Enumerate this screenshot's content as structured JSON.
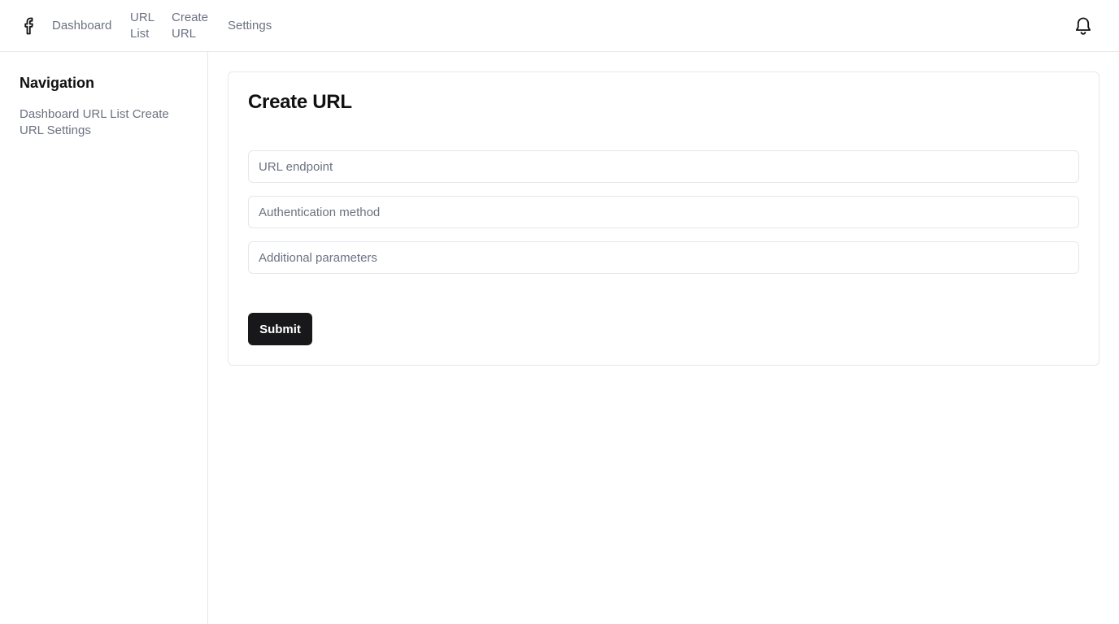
{
  "header": {
    "logo_icon": "facebook-logo-icon",
    "nav": [
      {
        "label": "Dashboard"
      },
      {
        "label": "URL List"
      },
      {
        "label": "Create URL"
      },
      {
        "label": "Settings"
      }
    ],
    "notification_icon": "bell-icon"
  },
  "sidebar": {
    "title": "Navigation",
    "links": [
      {
        "label": "Dashboard"
      },
      {
        "label": "URL List"
      },
      {
        "label": "Create URL"
      },
      {
        "label": "Settings"
      }
    ]
  },
  "main": {
    "title": "Create URL",
    "fields": [
      {
        "placeholder": "URL endpoint",
        "value": ""
      },
      {
        "placeholder": "Authentication method",
        "value": ""
      },
      {
        "placeholder": "Additional parameters",
        "value": ""
      }
    ],
    "submit_label": "Submit"
  },
  "colors": {
    "muted_text": "#6b7280",
    "border": "#e5e7eb",
    "button_bg": "#18181b",
    "button_text": "#ffffff"
  }
}
